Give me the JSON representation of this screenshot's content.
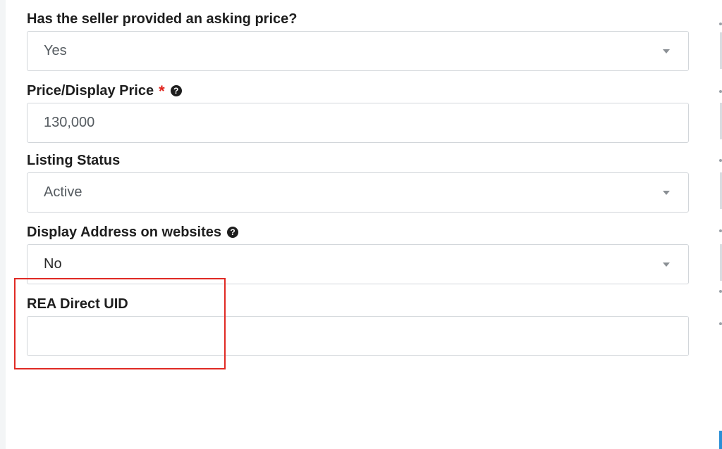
{
  "form": {
    "asking_price": {
      "label": "Has the seller provided an asking price?",
      "value": "Yes"
    },
    "price": {
      "label": "Price/Display Price",
      "required_marker": "*",
      "help_icon": "question-circle-icon",
      "value": "130,000"
    },
    "listing_status": {
      "label": "Listing Status",
      "value": "Active"
    },
    "display_address": {
      "label": "Display Address on websites",
      "help_icon": "question-circle-icon",
      "value": "No"
    },
    "rea_uid": {
      "label": "REA Direct UID",
      "value": "",
      "placeholder": ""
    }
  },
  "colors": {
    "required": "#e0231d",
    "highlight": "#e02a24",
    "border": "#d2d6da"
  }
}
